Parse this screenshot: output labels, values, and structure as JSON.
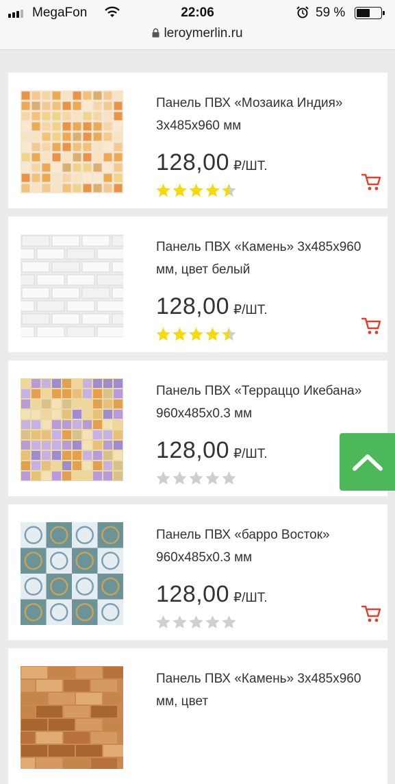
{
  "status_bar": {
    "carrier": "MegaFon",
    "time": "22:06",
    "battery_percent": "59 %",
    "battery_level": 0.59
  },
  "browser": {
    "url": "leroymerlin.ru"
  },
  "accent_color": "#e73c2d",
  "rating_color": "#f6d908",
  "fab_color": "#4bb859",
  "products": [
    {
      "title": "",
      "price": "",
      "unit": "",
      "rating": 0
    },
    {
      "title": "Панель ПВХ «Мозаика Индия» 3х485х960 мм",
      "price": "128,00",
      "unit": "₽/ШТ.",
      "rating": 4.5
    },
    {
      "title": "Панель ПВХ «Камень» 3х485х960 мм, цвет белый",
      "price": "128,00",
      "unit": "₽/ШТ.",
      "rating": 4.5
    },
    {
      "title": "Панель ПВХ «Терраццо Икебана» 960х485х0.3 мм",
      "price": "128,00",
      "unit": "₽/ШТ.",
      "rating": 0
    },
    {
      "title": "Панель ПВХ «барро Восток» 960х485х0.3 мм",
      "price": "128,00",
      "unit": "₽/ШТ.",
      "rating": 0
    },
    {
      "title": "Панель ПВХ «Камень» 3х485х960 мм, цвет",
      "price": "",
      "unit": "",
      "rating": 0
    }
  ],
  "icons": {
    "cart": "cart-icon",
    "scroll_top": "chevron-up-icon",
    "lock": "lock-icon",
    "wifi": "wifi-icon",
    "alarm": "alarm-icon"
  }
}
